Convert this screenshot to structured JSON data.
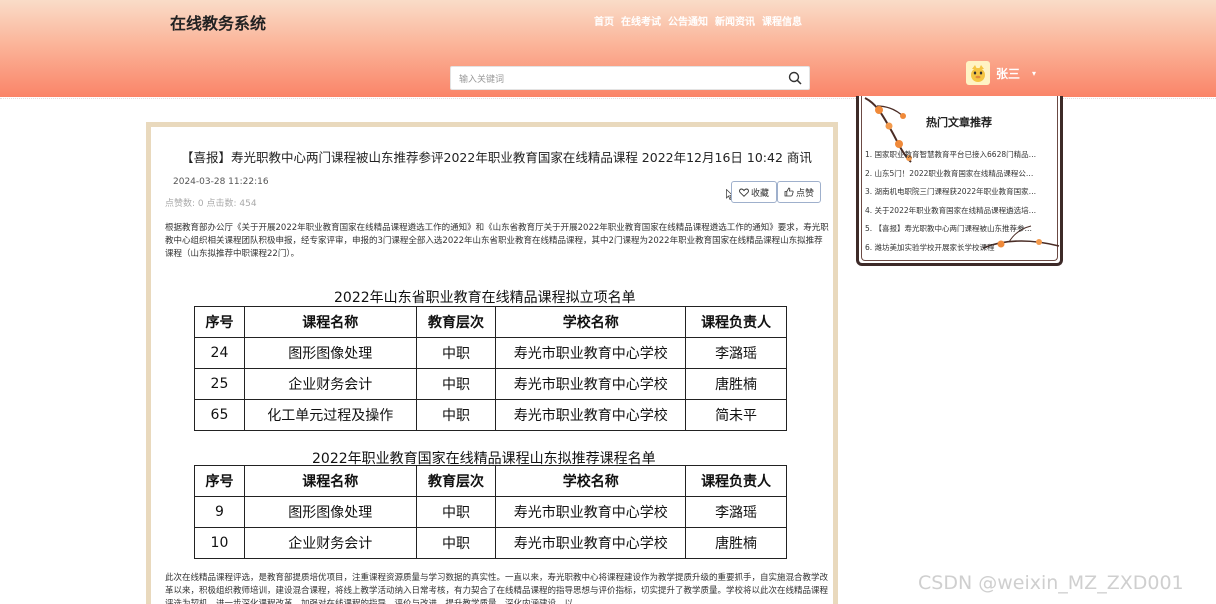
{
  "header": {
    "brand": "在线教务系统",
    "nav": [
      "首页",
      "在线考试",
      "公告通知",
      "新闻资讯",
      "课程信息"
    ],
    "search_placeholder": "输入关键词",
    "user_name": "张三"
  },
  "article": {
    "title": "【喜报】寿光职教中心两门课程被山东推荐参评2022年职业教育国家在线精品课程 2022年12月16日 10:42 商讯",
    "date": "2024-03-28 11:22:16",
    "stats": "点赞数: 0   点击数: 454",
    "fav_label": "收藏",
    "like_label": "点赞",
    "paragraph1": "根据教育部办公厅《关于开展2022年职业教育国家在线精品课程遴选工作的通知》和《山东省教育厅关于开展2022年职业教育国家在线精品课程遴选工作的通知》要求，寿光职教中心组织相关课程团队积极申报，经专家评审，申报的3门课程全部入选2022年山东省职业教育在线精品课程，其中2门课程为2022年职业教育国家在线精品课程山东拟推荐课程（山东拟推荐中职课程22门）。",
    "paragraph2": "此次在线精品课程评选，是教育部提质培优项目，注重课程资源质量与学习数据的真实性。一直以来，寿光职教中心将课程建设作为教学提质升级的重要抓手，自实施混合教学改革以来，积极组织教师培训，建设混合课程，将线上教学活动纳入日常考核，有力契合了在线精品课程的指导思想与评价指标，切实提升了教学质量。学校将以此次在线精品课程评选为契机，进一步深化课程改革，加强对在线课程的指导、评价与改进，提升教学质量，深化内涵建设，以"
  },
  "tables": [
    {
      "title": "2022年山东省职业教育在线精品课程拟立项名单",
      "headers": [
        "序号",
        "课程名称",
        "教育层次",
        "学校名称",
        "课程负责人"
      ],
      "rows": [
        [
          "24",
          "图形图像处理",
          "中职",
          "寿光市职业教育中心学校",
          "李潞瑶"
        ],
        [
          "25",
          "企业财务会计",
          "中职",
          "寿光市职业教育中心学校",
          "唐胜楠"
        ],
        [
          "65",
          "化工单元过程及操作",
          "中职",
          "寿光市职业教育中心学校",
          "简未平"
        ]
      ]
    },
    {
      "title": "2022年职业教育国家在线精品课程山东拟推荐课程名单",
      "headers": [
        "序号",
        "课程名称",
        "教育层次",
        "学校名称",
        "课程负责人"
      ],
      "rows": [
        [
          "9",
          "图形图像处理",
          "中职",
          "寿光市职业教育中心学校",
          "李潞瑶"
        ],
        [
          "10",
          "企业财务会计",
          "中职",
          "寿光市职业教育中心学校",
          "唐胜楠"
        ]
      ]
    }
  ],
  "sidebar": {
    "title": "热门文章推荐",
    "items": [
      "1. 国家职业教育智慧教育平台已接入6628门精品…",
      "2. 山东5门！2022职业教育国家在线精品课程公…",
      "3. 湖南机电职院三门课程获2022年职业教育国家…",
      "4. 关于2022年职业教育国家在线精品课程遴选培…",
      "5. 【喜报】寿光职教中心两门课程被山东推荐参…",
      "6. 潍坊美加实验学校开展家长学校课程"
    ]
  },
  "watermark": "CSDN @weixin_MZ_ZXD001",
  "colors": {
    "header_top": "#f9dcc8",
    "header_bottom": "#fa8468",
    "card_border": "#e9d9bd",
    "sidebar_border": "#3d2a28"
  }
}
